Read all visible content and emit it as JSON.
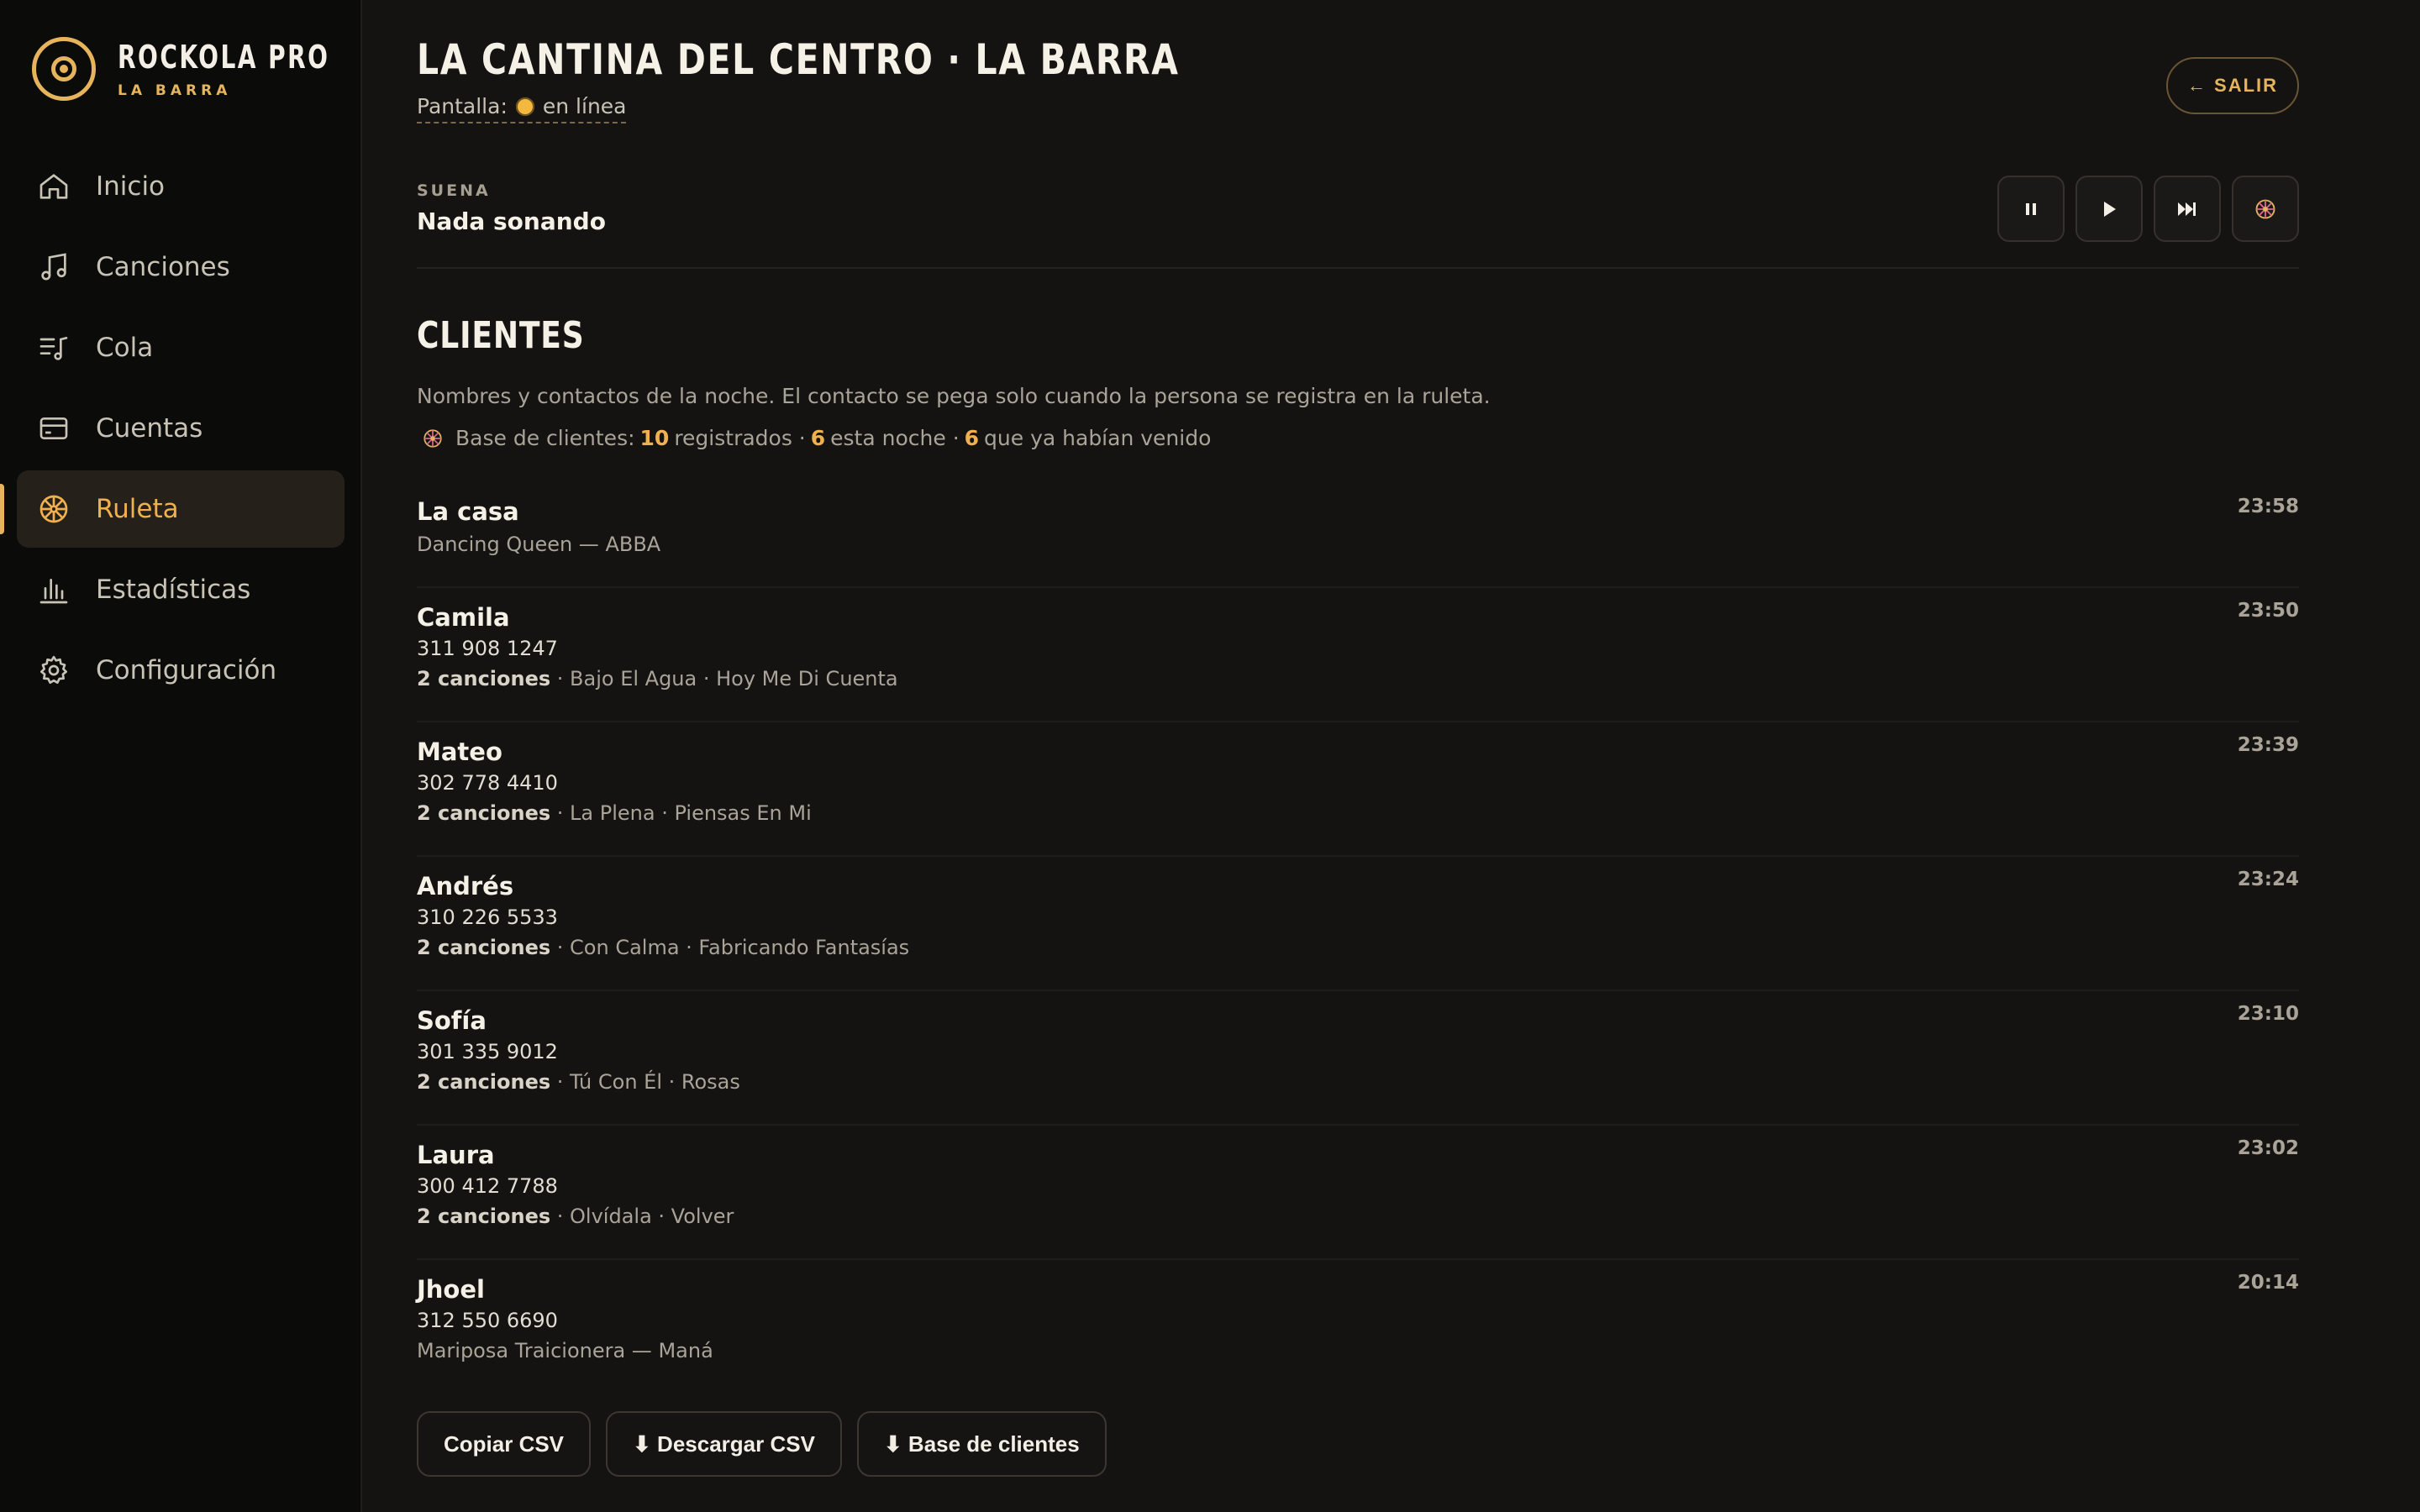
{
  "brand": {
    "title": "ROCKOLA PRO",
    "subtitle": "LA BARRA"
  },
  "sidebar": {
    "items": [
      {
        "label": "Inicio",
        "icon": "home-icon",
        "active": false
      },
      {
        "label": "Canciones",
        "icon": "music-note-icon",
        "active": false
      },
      {
        "label": "Cola",
        "icon": "queue-icon",
        "active": false
      },
      {
        "label": "Cuentas",
        "icon": "card-icon",
        "active": false
      },
      {
        "label": "Ruleta",
        "icon": "wheel-icon",
        "active": true
      },
      {
        "label": "Estadísticas",
        "icon": "bar-chart-icon",
        "active": false
      },
      {
        "label": "Configuración",
        "icon": "gear-icon",
        "active": false
      }
    ]
  },
  "header": {
    "title": "LA CANTINA DEL CENTRO · LA BARRA",
    "screen_label": "Pantalla:",
    "screen_status": "en línea",
    "exit_label": "← SALIR"
  },
  "player": {
    "now_label": "SUENA",
    "now_track": "Nada sonando",
    "controls": [
      "pause-icon",
      "play-icon",
      "skip-icon",
      "wheel-icon"
    ]
  },
  "clients_section": {
    "title": "CLIENTES",
    "description": "Nombres y contactos de la noche. El contacto se pega solo cuando la persona se registra en la ruleta.",
    "base_prefix": "Base de clientes:",
    "registered": "10",
    "registered_label": "registrados ·",
    "tonight": "6",
    "tonight_label": "esta noche ·",
    "returning": "6",
    "returning_label": "que ya habían venido"
  },
  "clients": [
    {
      "name": "La casa",
      "phone": "",
      "songs_count": "",
      "songs": "Dancing Queen — ABBA",
      "time": "23:58"
    },
    {
      "name": "Camila",
      "phone": "311 908 1247",
      "songs_count": "2 canciones",
      "songs": " · Bajo El Agua · Hoy Me Di Cuenta",
      "time": "23:50"
    },
    {
      "name": "Mateo",
      "phone": "302 778 4410",
      "songs_count": "2 canciones",
      "songs": " · La Plena · Piensas En Mi",
      "time": "23:39"
    },
    {
      "name": "Andrés",
      "phone": "310 226 5533",
      "songs_count": "2 canciones",
      "songs": " · Con Calma · Fabricando Fantasías",
      "time": "23:24"
    },
    {
      "name": "Sofía",
      "phone": "301 335 9012",
      "songs_count": "2 canciones",
      "songs": " · Tú Con Él · Rosas",
      "time": "23:10"
    },
    {
      "name": "Laura",
      "phone": "300 412 7788",
      "songs_count": "2 canciones",
      "songs": " · Olvídala · Volver",
      "time": "23:02"
    },
    {
      "name": "Jhoel",
      "phone": "312 550 6690",
      "songs_count": "",
      "songs": "Mariposa Traicionera — Maná",
      "time": "20:14"
    }
  ],
  "footer": {
    "copy_csv": "Copiar CSV",
    "download_csv": "⬇ Descargar CSV",
    "client_base": "⬇ Base de clientes"
  },
  "colors": {
    "accent": "#e6b45c",
    "background": "#141312",
    "sidebar": "#0b0b0a"
  }
}
